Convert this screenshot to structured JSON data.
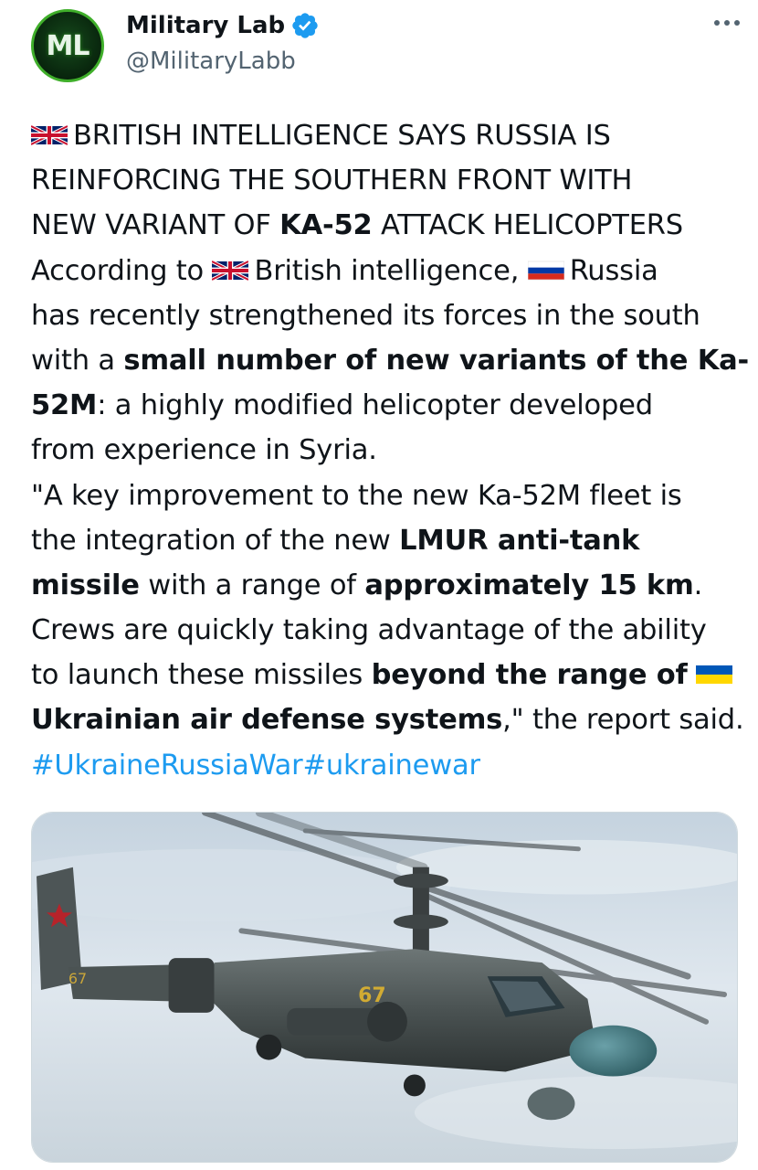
{
  "account": {
    "avatar_text": "ML",
    "display_name": "Military Lab",
    "handle": "@MilitaryLabb",
    "verified_icon": "verified-badge-icon"
  },
  "menu_icon": "more-options-icon",
  "tweet": {
    "lines": [
      [
        {
          "flag": "uk"
        },
        {
          "t": "BRITISH INTELLIGENCE SAYS RUSSIA IS"
        }
      ],
      [
        {
          "t": "REINFORCING THE SOUTHERN FRONT WITH"
        }
      ],
      [
        {
          "t": "NEW VARIANT OF "
        },
        {
          "t": "KA-52",
          "b": true
        },
        {
          "t": " ATTACK HELICOPTERS"
        }
      ],
      [
        {
          "t": "According to "
        },
        {
          "flag": "uk"
        },
        {
          "t": "British intelligence, "
        },
        {
          "flag": "ru"
        },
        {
          "t": "Russia"
        }
      ],
      [
        {
          "t": "has recently strengthened its forces in the south"
        }
      ],
      [
        {
          "t": "with a "
        },
        {
          "t": "small number of new variants of the  Ka-",
          "b": true
        }
      ],
      [
        {
          "t": "52M",
          "b": true
        },
        {
          "t": ": a highly modified helicopter developed"
        }
      ],
      [
        {
          "t": "from experience in Syria."
        }
      ],
      [
        {
          "t": "\"A key improvement to the new Ka-52M fleet is"
        }
      ],
      [
        {
          "t": "the integration of the new "
        },
        {
          "t": "LMUR anti-tank",
          "b": true
        }
      ],
      [
        {
          "t": "missile",
          "b": true
        },
        {
          "t": " with a range of "
        },
        {
          "t": "approximately 15 km",
          "b": true
        },
        {
          "t": "."
        }
      ],
      [
        {
          "t": "Crews  are quickly taking advantage of the ability"
        }
      ],
      [
        {
          "t": "to launch these missiles  "
        },
        {
          "t": "beyond the range of",
          "b": true
        },
        {
          "t": " "
        },
        {
          "flag": "ua"
        }
      ],
      [
        {
          "t": "Ukrainian air defense systems",
          "b": true
        },
        {
          "t": ",\" the report said."
        }
      ],
      [
        {
          "t": "#UkraineRussiaWar",
          "link": true
        },
        {
          "t": "#ukrainewar",
          "link": true
        }
      ]
    ]
  },
  "media": {
    "alt_subject": "Ka-52 attack helicopter",
    "markings": [
      "67",
      "67"
    ]
  },
  "colors": {
    "link": "#1d9bf0",
    "text": "#0f1419",
    "secondary": "#536471",
    "verified": "#1d9bf0",
    "avatar_ring": "#3fae2a"
  }
}
